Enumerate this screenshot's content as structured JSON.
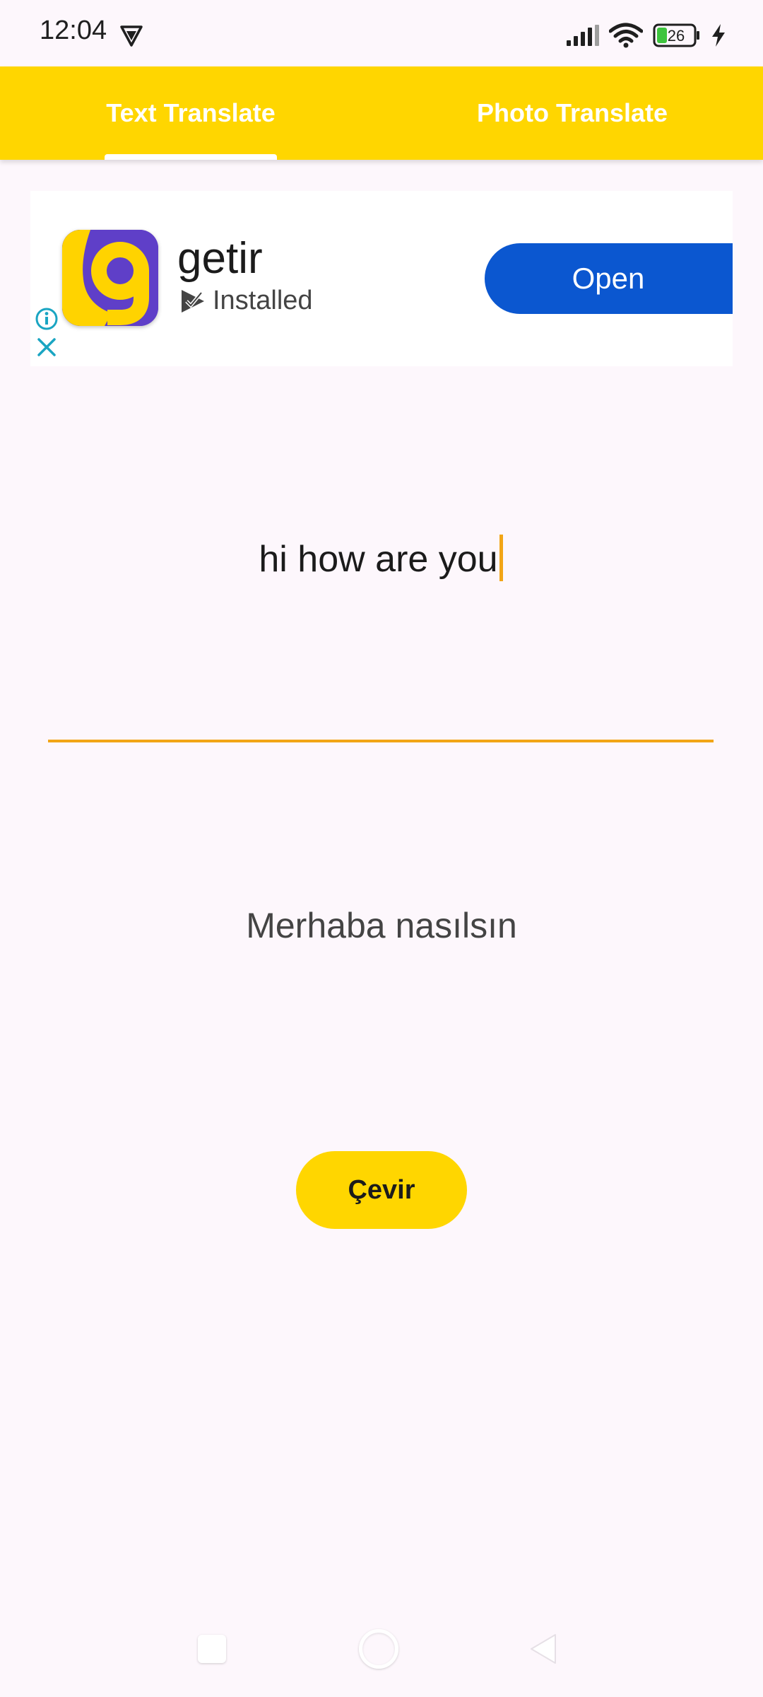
{
  "status_bar": {
    "time": "12:04",
    "battery_level": "26",
    "icons": [
      "vpn-shield-icon",
      "signal-icon",
      "wifi-icon",
      "battery-icon",
      "charging-icon"
    ]
  },
  "tabs": [
    {
      "label": "Text Translate",
      "selected": true
    },
    {
      "label": "Photo Translate",
      "selected": false
    }
  ],
  "ad": {
    "app_name": "getir",
    "status": "Installed",
    "cta_label": "Open",
    "icons": [
      "ad-info-icon",
      "ad-close-icon",
      "installed-check-icon"
    ]
  },
  "input": {
    "value": "hi how are you"
  },
  "output": {
    "text": "Merhaba nasılsın"
  },
  "actions": {
    "translate_label": "Çevir"
  },
  "nav_bar": {
    "icons": [
      "recents-icon",
      "home-icon",
      "back-icon"
    ]
  },
  "colors": {
    "accent": "#ffd600",
    "underline": "#f2a516",
    "ad_button": "#0b57d0",
    "background": "#fdf7fc"
  }
}
